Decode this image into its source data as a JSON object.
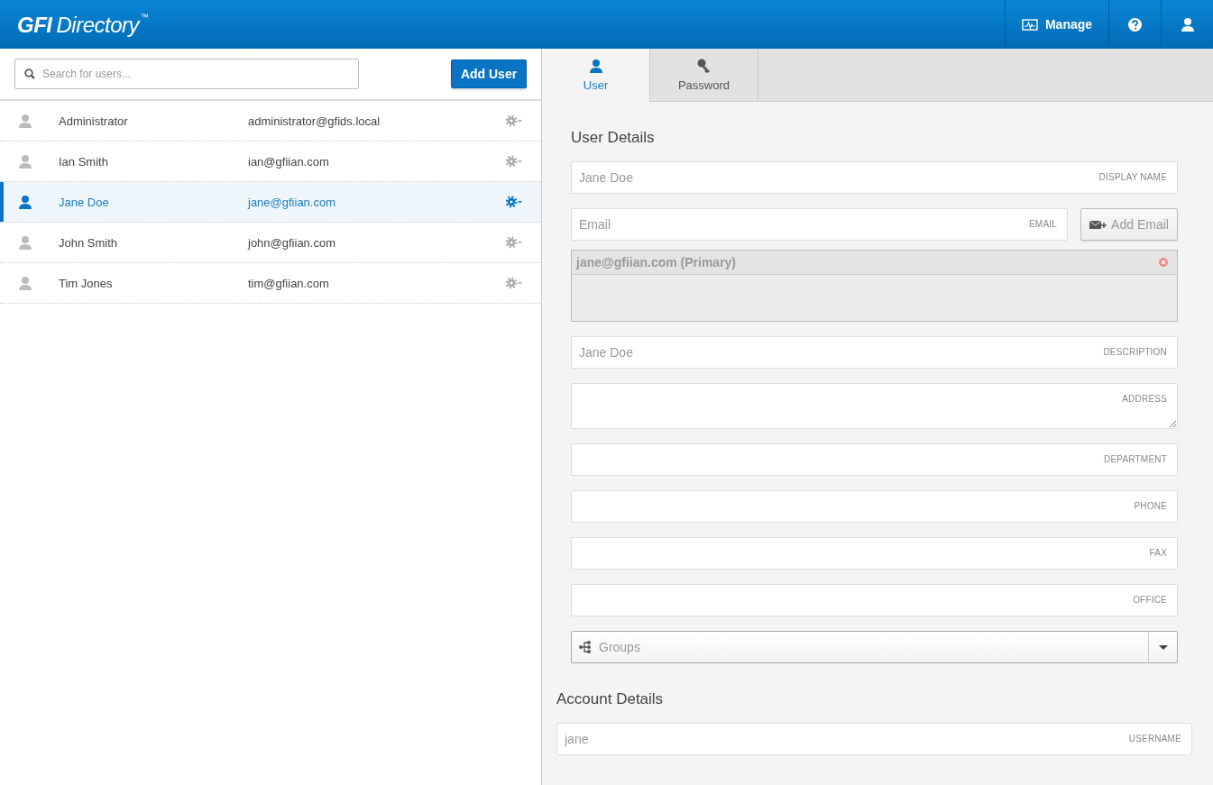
{
  "header": {
    "logo_bold": "GFI",
    "logo_text": "Directory",
    "logo_mark": "™",
    "actions": [
      {
        "kind": "manage",
        "label": "Manage"
      },
      {
        "kind": "help"
      },
      {
        "kind": "account"
      }
    ]
  },
  "search": {
    "placeholder": "Search for users..."
  },
  "add_button": "Add User",
  "users": [
    {
      "name": "Administrator",
      "email": "administrator@gfids.local",
      "selected": false
    },
    {
      "name": "Ian Smith",
      "email": "ian@gfiian.com",
      "selected": false
    },
    {
      "name": "Jane Doe",
      "email": "jane@gfiian.com",
      "selected": true
    },
    {
      "name": "John Smith",
      "email": "john@gfiian.com",
      "selected": false
    },
    {
      "name": "Tim Jones",
      "email": "tim@gfiian.com",
      "selected": false
    }
  ],
  "tabs": [
    {
      "kind": "user",
      "label": "User",
      "selected": true
    },
    {
      "kind": "password",
      "label": "Password",
      "selected": false
    }
  ],
  "user_details": {
    "title": "User Details",
    "fields": [
      {
        "kind": "text",
        "value": "Jane Doe",
        "label": "DISPLAY NAME"
      },
      {
        "kind": "email",
        "placeholder": "Email",
        "label": "EMAIL",
        "button": "Add Email",
        "emails": [
          {
            "address": "jane@gfiian.com (Primary)"
          }
        ]
      },
      {
        "kind": "text",
        "value": "Jane Doe",
        "label": "DESCRIPTION"
      },
      {
        "kind": "textarea",
        "label": "ADDRESS"
      },
      {
        "kind": "text",
        "label": "DEPARTMENT"
      },
      {
        "kind": "text",
        "label": "PHONE"
      },
      {
        "kind": "text",
        "label": "FAX"
      },
      {
        "kind": "text",
        "label": "OFFICE"
      },
      {
        "kind": "select",
        "placeholder": "Groups"
      }
    ]
  },
  "account_details": {
    "title": "Account Details",
    "fields": [
      {
        "kind": "text",
        "value": "jane",
        "label": "USERNAME"
      }
    ]
  }
}
